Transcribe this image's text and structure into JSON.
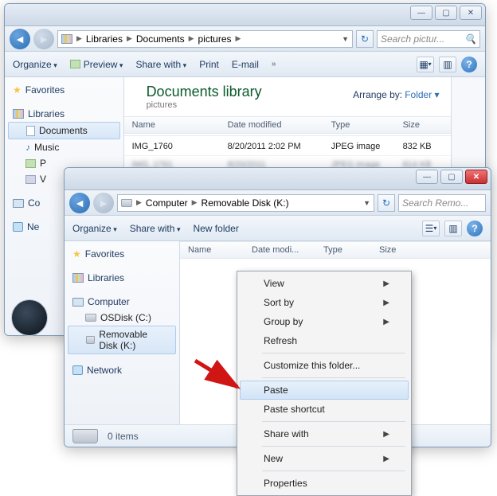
{
  "win1": {
    "title": "",
    "breadcrumb": [
      "Libraries",
      "Documents",
      "pictures"
    ],
    "search_placeholder": "Search pictur...",
    "toolbar": {
      "organize": "Organize",
      "preview": "Preview",
      "share": "Share with",
      "print": "Print",
      "email": "E-mail"
    },
    "sidebar": {
      "favorites": "Favorites",
      "libraries": "Libraries",
      "documents": "Documents",
      "music": "Music",
      "pictures": "P",
      "videos": "V",
      "computer": "Co",
      "network": "Ne"
    },
    "libheader": {
      "title": "Documents library",
      "subtitle": "pictures",
      "arrange_by": "Arrange by:",
      "arrange_val": "Folder"
    },
    "columns": {
      "name": "Name",
      "date": "Date modified",
      "type": "Type",
      "size": "Size"
    },
    "rows": [
      {
        "name": "IMG_1760",
        "date": "8/20/2011 2:02 PM",
        "type": "JPEG image",
        "size": "832 KB"
      }
    ]
  },
  "win2": {
    "breadcrumb": [
      "Computer",
      "Removable Disk (K:)"
    ],
    "search_placeholder": "Search Remo...",
    "toolbar": {
      "organize": "Organize",
      "share": "Share with",
      "newfolder": "New folder"
    },
    "sidebar": {
      "favorites": "Favorites",
      "libraries": "Libraries",
      "computer": "Computer",
      "osdisk": "OSDisk (C:)",
      "removable": "Removable Disk (K:)",
      "network": "Network"
    },
    "columns": {
      "name": "Name",
      "date": "Date modi...",
      "type": "Type",
      "size": "Size"
    },
    "status": {
      "count": "0 items"
    }
  },
  "context_menu": {
    "view": "View",
    "sortby": "Sort by",
    "groupby": "Group by",
    "refresh": "Refresh",
    "customize": "Customize this folder...",
    "paste": "Paste",
    "paste_shortcut": "Paste shortcut",
    "sharewith": "Share with",
    "new": "New",
    "properties": "Properties"
  }
}
